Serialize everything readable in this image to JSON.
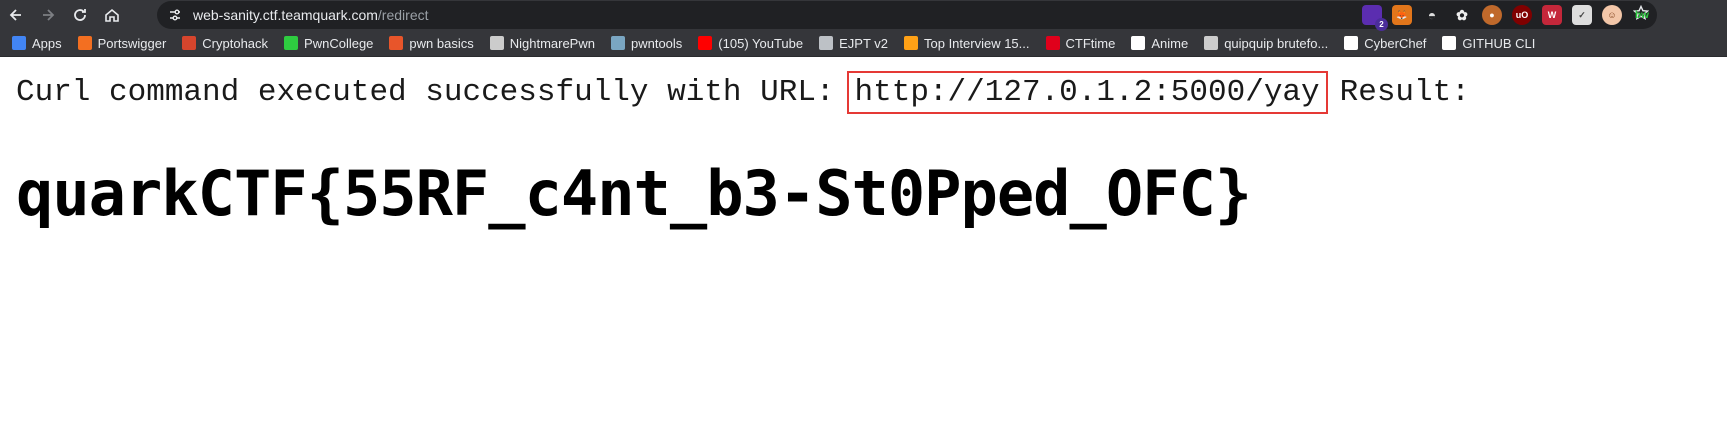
{
  "browser": {
    "url_host": "web-sanity.ctf.teamquark.com",
    "url_path": "/redirect",
    "extension_badge": "2",
    "extensions": [
      "purple-ext-icon",
      "fox-ext-icon",
      "hat-ext-icon",
      "paw-ext-icon",
      "cookie-ext-icon",
      "ublock-icon",
      "wappalyzer-icon",
      "checklist-icon",
      "avatar-ext-icon",
      "green-ext-icon"
    ]
  },
  "bookmarks": [
    {
      "label": "Apps",
      "icon": "apps-grid-icon",
      "color": "#4285f4"
    },
    {
      "label": "Portswigger",
      "icon": "portswigger-icon",
      "color": "#f36f21"
    },
    {
      "label": "Cryptohack",
      "icon": "cryptohack-icon",
      "color": "#d6452d"
    },
    {
      "label": "PwnCollege",
      "icon": "pwncollege-icon",
      "color": "#2ecc40"
    },
    {
      "label": "pwn basics",
      "icon": "pwn-basics-icon",
      "color": "#e8552a"
    },
    {
      "label": "NightmarePwn",
      "icon": "book-icon",
      "color": "#cccccc"
    },
    {
      "label": "pwntools",
      "icon": "pwntools-icon",
      "color": "#7aa6c2"
    },
    {
      "label": "(105) YouTube",
      "icon": "youtube-icon",
      "color": "#ff0000"
    },
    {
      "label": "EJPT v2",
      "icon": "globe-icon",
      "color": "#bdc1c6"
    },
    {
      "label": "Top Interview 15...",
      "icon": "leetcode-icon",
      "color": "#ffa116"
    },
    {
      "label": "CTFtime",
      "icon": "ctftime-icon",
      "color": "#e0001b"
    },
    {
      "label": "Anime",
      "icon": "anime-icon",
      "color": "#ffffff"
    },
    {
      "label": "quipquip brutefo...",
      "icon": "search-bookmark-icon",
      "color": "#cccccc"
    },
    {
      "label": "CyberChef",
      "icon": "chef-hat-icon",
      "color": "#ffffff"
    },
    {
      "label": "GITHUB CLI",
      "icon": "github-icon",
      "color": "#ffffff"
    }
  ],
  "page": {
    "prefix": "Curl command executed successfully with URL:",
    "url": "http://127.0.1.2:5000/yay",
    "suffix": "Result:",
    "flag": "quarkCTF{55RF_c4nt_b3-St0Pped_OFC}"
  },
  "colors": {
    "highlight_box": "#e53935"
  }
}
